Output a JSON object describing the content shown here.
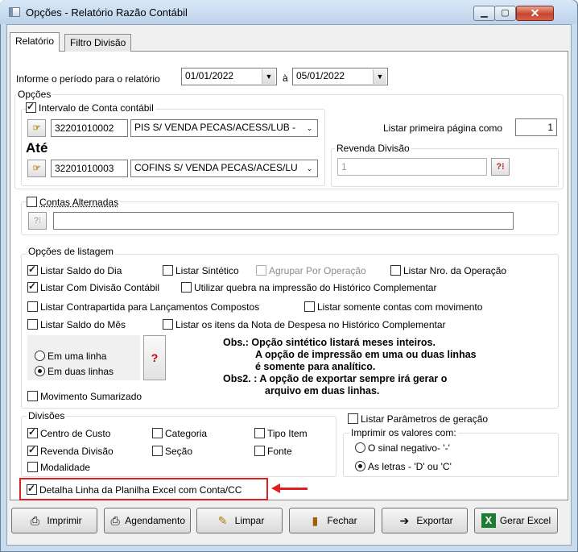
{
  "window": {
    "title": "Opções - Relatório Razão Contábil",
    "minimize": "▁",
    "maximize": "▢",
    "close": "✕"
  },
  "tabs": [
    {
      "label": "Relatório"
    },
    {
      "label": "Filtro Divisão"
    }
  ],
  "periodo": {
    "label": "Informe o período para o relatório",
    "from": "01/01/2022",
    "sep": "à",
    "to": "05/01/2022"
  },
  "opcoes": {
    "title": "Opções",
    "intervalo": {
      "label": "Intervalo de Conta contábil",
      "checked": true
    },
    "conta_de": {
      "code": "32201010002",
      "name": "PIS S/ VENDA PECAS/ACESS/LUB -"
    },
    "ate": "Até",
    "conta_ate": {
      "code": "32201010003",
      "name": "COFINS S/ VENDA PECAS/ACES/LU"
    },
    "primeira_pagina": {
      "label": "Listar primeira página como",
      "value": "1"
    },
    "revenda": {
      "title": "Revenda Divisão",
      "value": "1"
    },
    "contas_alternadas": {
      "label": "Contas Alternadas",
      "checked": false,
      "value": ""
    }
  },
  "listagem": {
    "title": "Opções de listagem",
    "items": [
      {
        "label": "Listar Saldo do Dia",
        "checked": true
      },
      {
        "label": "Listar Sintético",
        "checked": false
      },
      {
        "label": "Agrupar Por Operação",
        "checked": false,
        "disabled": true
      },
      {
        "label": "Listar Nro. da Operação",
        "checked": false
      },
      {
        "label": "Listar Com Divisão Contábil",
        "checked": true
      },
      {
        "label": "Utilizar quebra na impressão do Histórico Complementar",
        "checked": false
      },
      {
        "label": "Listar Contrapartida para Lançamentos Compostos",
        "checked": false
      },
      {
        "label": "Listar somente contas com movimento",
        "checked": false
      },
      {
        "label": "Listar Saldo do Mês",
        "checked": false
      },
      {
        "label": "Listar os itens da Nota de Despesa no Histórico Complementar",
        "checked": false
      }
    ],
    "linhas": [
      {
        "label": "Em uma linha",
        "selected": false
      },
      {
        "label": "Em duas linhas",
        "selected": true
      }
    ],
    "help": "?",
    "obs_lines": [
      "Obs.: Opção sintético listará meses inteiros.",
      "A opção de impressão em uma ou duas linhas",
      "é somente para analítico.",
      "Obs2. : A opção de exportar sempre irá gerar o",
      "arquivo em duas linhas."
    ],
    "movimento": {
      "label": "Movimento Sumarizado",
      "checked": false
    }
  },
  "divisoes": {
    "title": "Divisões",
    "items": [
      {
        "label": "Centro de Custo",
        "checked": true
      },
      {
        "label": "Categoria",
        "checked": false
      },
      {
        "label": "Tipo Item",
        "checked": false
      },
      {
        "label": "Revenda Divisão",
        "checked": true
      },
      {
        "label": "Seção",
        "checked": false
      },
      {
        "label": "Fonte",
        "checked": false
      },
      {
        "label": "Modalidade",
        "checked": false
      }
    ]
  },
  "parametros": {
    "label": "Listar Parâmetros de geração",
    "checked": false
  },
  "imprimir_valores": {
    "title": "Imprimir os valores com:",
    "options": [
      {
        "label": "O sinal negativo- '-'",
        "selected": false
      },
      {
        "label": "As letras - 'D' ou  'C'",
        "selected": true
      }
    ]
  },
  "detalha": {
    "label": "Detalha Linha da Planilha Excel com Conta/CC",
    "checked": true
  },
  "buttons": {
    "imprimir": {
      "label": "Imprimir"
    },
    "agendamento": {
      "label": "Agendamento"
    },
    "limpar": {
      "label": "Limpar"
    },
    "fechar": {
      "label": "Fechar"
    },
    "exportar": {
      "label": "Exportar"
    },
    "gerar_excel": {
      "label": "Gerar Excel"
    }
  },
  "accent": {
    "highlight": "#e02020",
    "excel_green": "#1e7b34"
  }
}
